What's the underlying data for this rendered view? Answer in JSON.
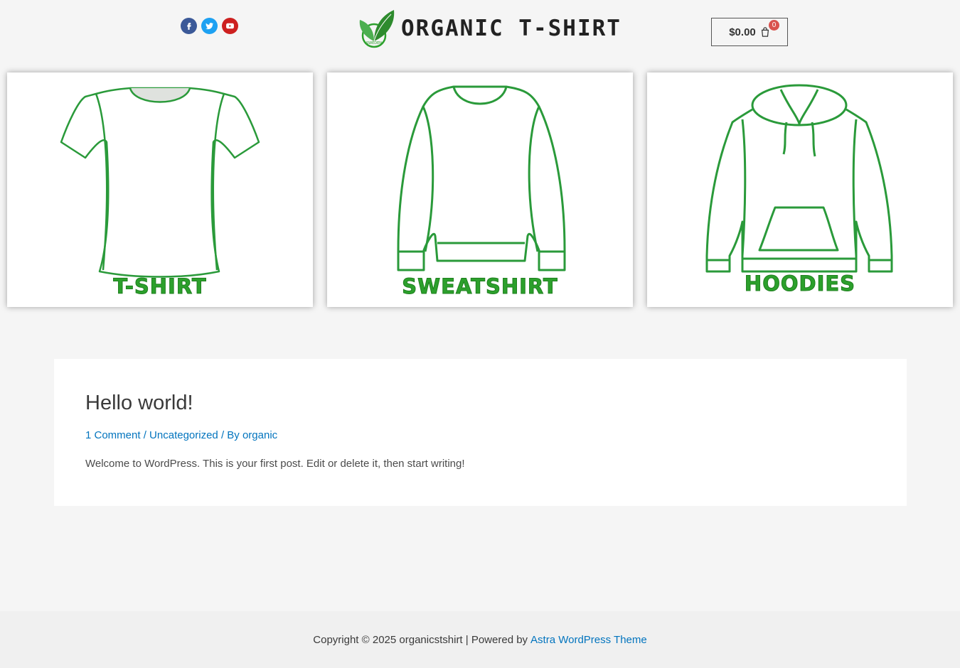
{
  "header": {
    "social": [
      {
        "name": "facebook-icon",
        "color": "#3b5998"
      },
      {
        "name": "twitter-icon",
        "color": "#1da1f2"
      },
      {
        "name": "youtube-icon",
        "color": "#cd201f"
      }
    ],
    "logo_text": "ORGANIC T-SHIRT",
    "logo_mark_text": "SWEDEN",
    "cart": {
      "amount": "$0.00",
      "count": "0",
      "icon": "shopping-bag-icon"
    }
  },
  "categories": [
    {
      "label": "T-SHIRT",
      "icon": "tshirt-icon"
    },
    {
      "label": "SWEATSHIRT",
      "icon": "sweatshirt-icon"
    },
    {
      "label": "HOODIES",
      "icon": "hoodie-icon"
    }
  ],
  "post": {
    "title": "Hello world!",
    "comments": "1 Comment",
    "sep1": " / ",
    "category": "Uncategorized",
    "by": " / By ",
    "author": "organic",
    "excerpt": "Welcome to WordPress. This is your first post. Edit or delete it, then start writing!"
  },
  "footer": {
    "copyright": "Copyright © 2025 organicstshirt | Powered by",
    "theme_link": "Astra WordPress Theme"
  },
  "colors": {
    "accent_green": "#2ca02c",
    "link_blue": "#0274be",
    "badge_red": "#d9534f"
  }
}
